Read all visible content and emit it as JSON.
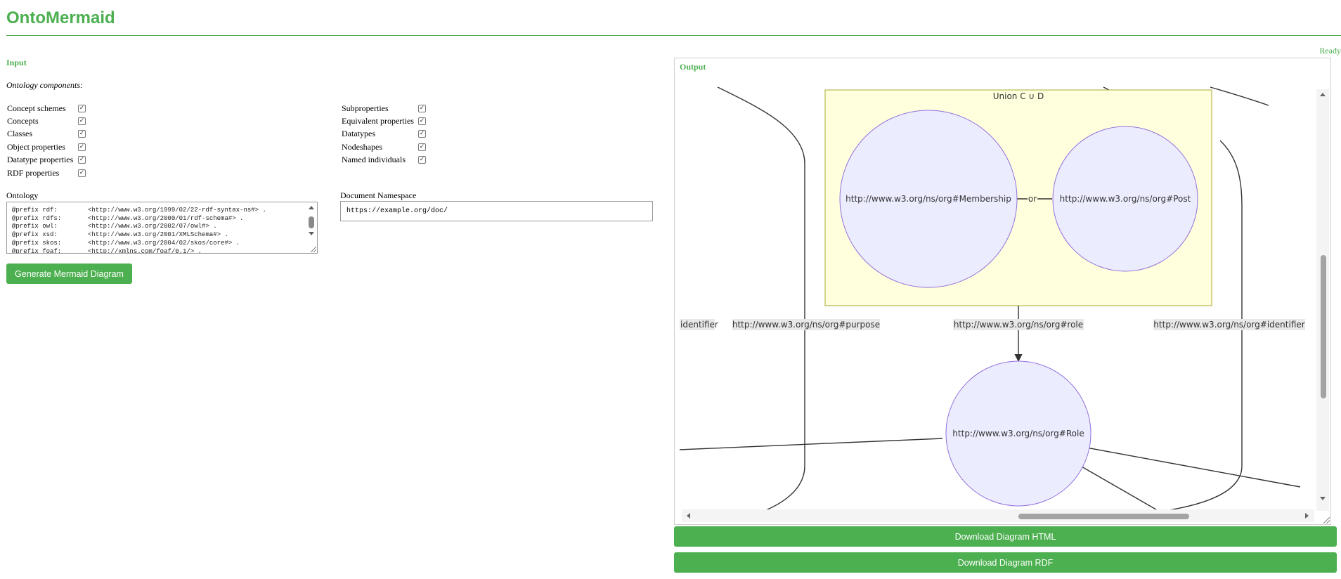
{
  "app": {
    "title": "OntoMermaid",
    "status": "Ready"
  },
  "input": {
    "heading": "Input",
    "components_label": "Ontology components:",
    "components_left": [
      {
        "label": "Concept schemes",
        "checked": true
      },
      {
        "label": "Concepts",
        "checked": true
      },
      {
        "label": "Classes",
        "checked": true
      },
      {
        "label": "Object properties",
        "checked": true
      },
      {
        "label": "Datatype properties",
        "checked": true
      },
      {
        "label": "RDF properties",
        "checked": true
      }
    ],
    "components_right": [
      {
        "label": "Subproperties",
        "checked": true
      },
      {
        "label": "Equivalent properties",
        "checked": true
      },
      {
        "label": "Datatypes",
        "checked": true
      },
      {
        "label": "Nodeshapes",
        "checked": true
      },
      {
        "label": "Named individuals",
        "checked": true
      }
    ],
    "ontology_label": "Ontology",
    "ontology_text": "@prefix rdf:        <http://www.w3.org/1999/02/22-rdf-syntax-ns#> .\n@prefix rdfs:       <http://www.w3.org/2000/01/rdf-schema#> .\n@prefix owl:        <http://www.w3.org/2002/07/owl#> .\n@prefix xsd:        <http://www.w3.org/2001/XMLSchema#> .\n@prefix skos:       <http://www.w3.org/2004/02/skos/core#> .\n@prefix foaf:       <http://xmlns.com/foaf/0.1/> .",
    "namespace_label": "Document Namespace",
    "namespace_value": "https://example.org/doc/",
    "generate_button": "Generate Mermaid Diagram"
  },
  "output": {
    "heading": "Output",
    "union_label": "Union C ∪ D",
    "node_membership": "http://www.w3.org/ns/org#Membership",
    "node_post": "http://www.w3.org/ns/org#Post",
    "node_role": "http://www.w3.org/ns/org#Role",
    "or_label": "or",
    "edge_identifier_left": "identifier",
    "edge_purpose": "http://www.w3.org/ns/org#purpose",
    "edge_role": "http://www.w3.org/ns/org#role",
    "edge_identifier_right": "http://www.w3.org/ns/org#identifier",
    "colors": {
      "node_fill": "#ECECFF",
      "node_stroke": "#9370DB",
      "cluster_fill": "#FFFFDE",
      "cluster_stroke": "#AAAA33",
      "edge_label_bg": "#E8E8E8"
    }
  },
  "actions": {
    "download_html": "Download Diagram HTML",
    "download_rdf": "Download Diagram RDF"
  }
}
